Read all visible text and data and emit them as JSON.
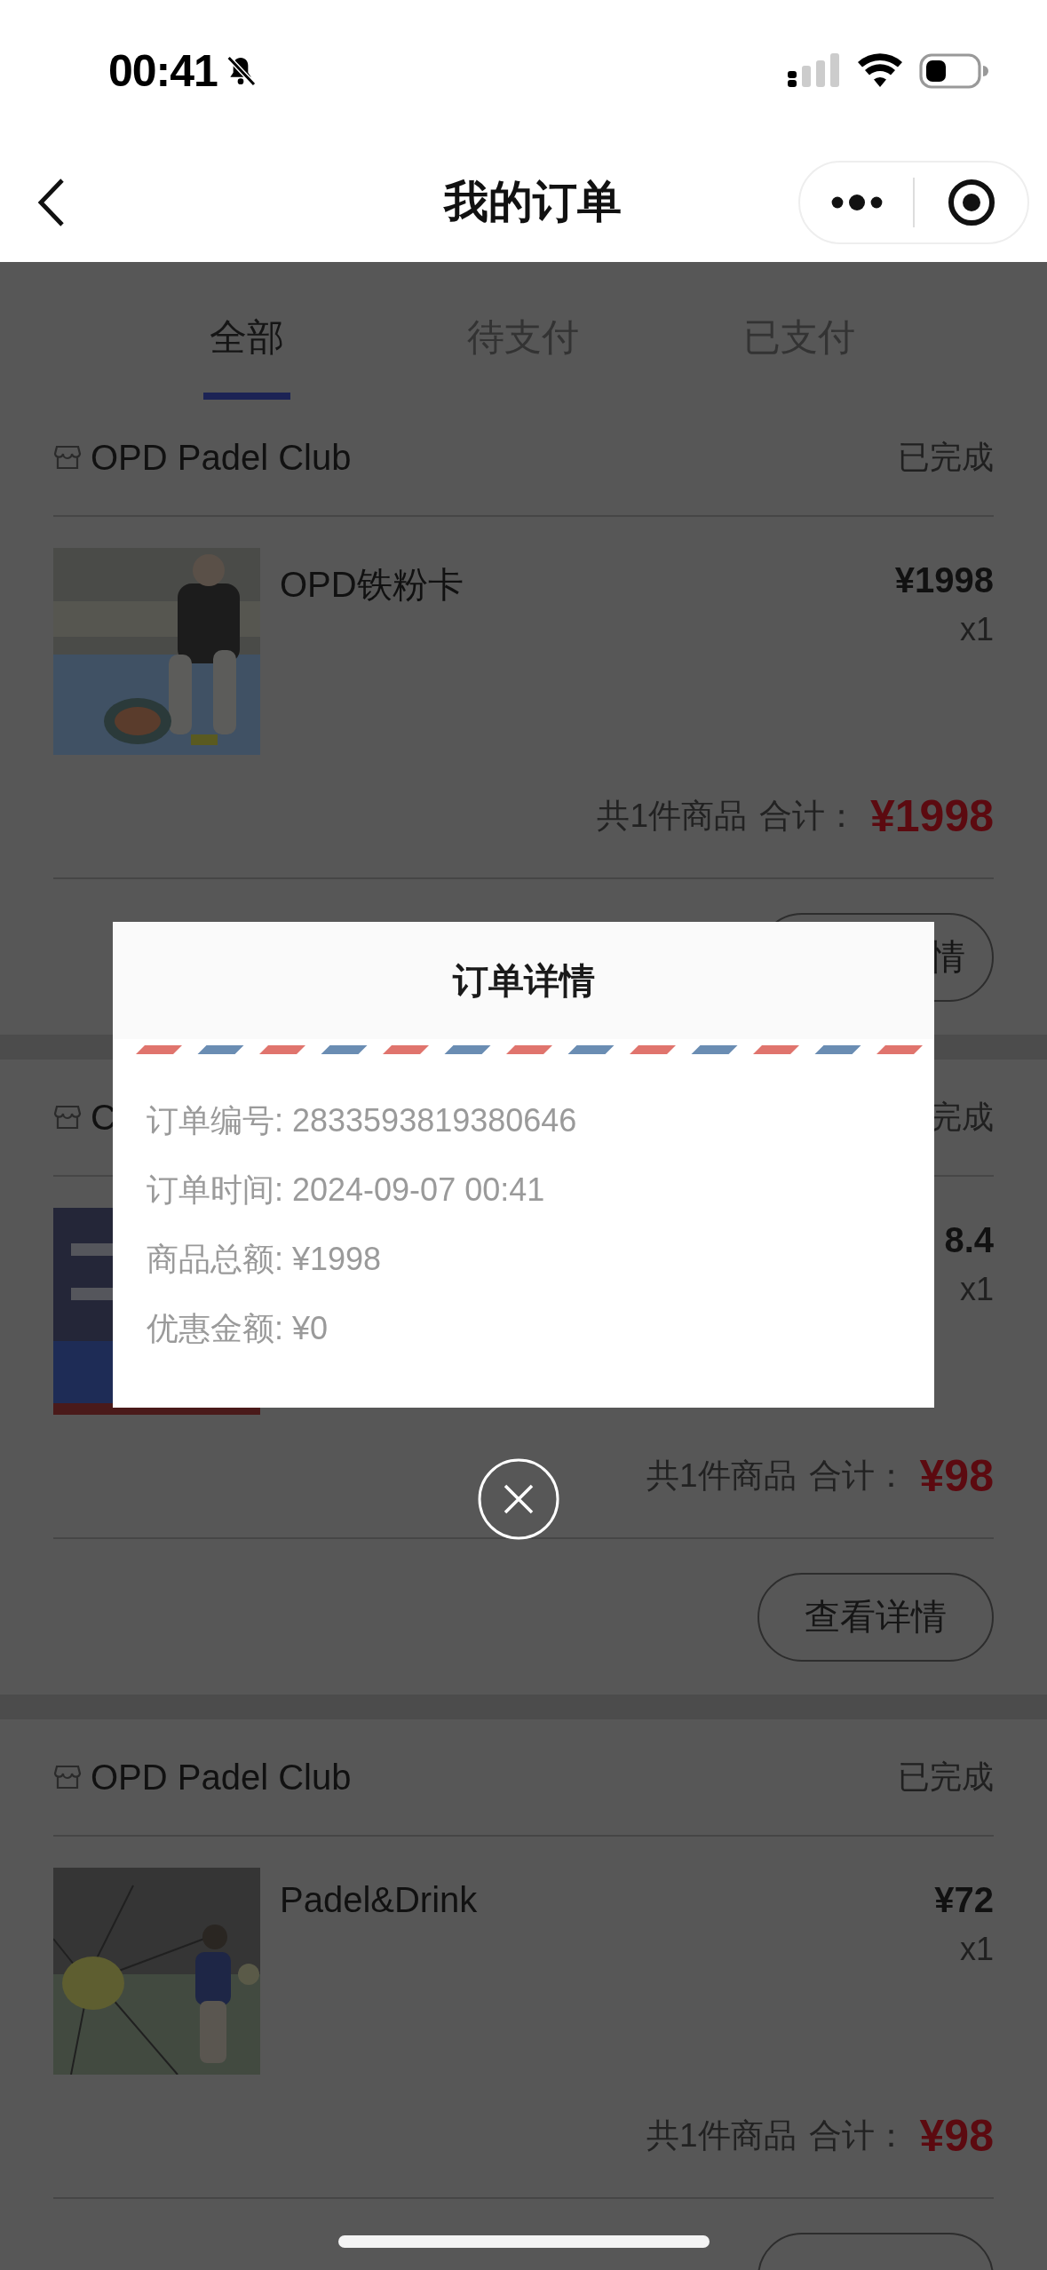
{
  "status_bar": {
    "time": "00:41"
  },
  "nav": {
    "title": "我的订单"
  },
  "tabs": [
    {
      "label": "全部",
      "selected": true
    },
    {
      "label": "待支付",
      "selected": false
    },
    {
      "label": "已支付",
      "selected": false
    }
  ],
  "orders": [
    {
      "shop": "OPD Padel Club",
      "status": "已完成",
      "product": "OPD铁粉卡",
      "price": "¥1998",
      "quantity": "x1",
      "count_text": "共1件商品",
      "total_label": "合计：",
      "total": "¥1998",
      "button": "情"
    },
    {
      "shop": "C",
      "status": "完成",
      "price": "8.4",
      "quantity": "x1",
      "count_text": "共1件商品",
      "total_label": "合计：",
      "total": "¥98",
      "button": "查看详情"
    },
    {
      "shop": "OPD Padel Club",
      "status": "已完成",
      "product": "Padel&Drink",
      "price": "¥72",
      "quantity": "x1",
      "count_text": "共1件商品",
      "total_label": "合计：",
      "total": "¥98"
    }
  ],
  "modal": {
    "title": "订单详情",
    "rows": [
      "订单编号: 2833593819380646",
      "订单时间: 2024-09-07 00:41",
      "商品总额: ¥1998",
      "优惠金额: ¥0"
    ]
  }
}
